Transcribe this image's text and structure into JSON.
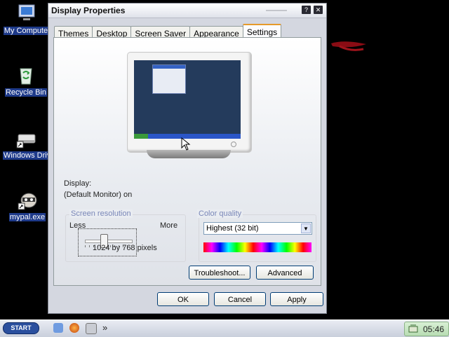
{
  "desktop": {
    "icons": [
      {
        "label": "My Compute"
      },
      {
        "label": "Recycle Bin"
      },
      {
        "label": "Windows Driv"
      },
      {
        "label": "mypal.exe"
      }
    ]
  },
  "window": {
    "title": "Display Properties",
    "help_glyph": "?",
    "close_glyph": "✕",
    "tabs": [
      {
        "label": "Themes"
      },
      {
        "label": "Desktop"
      },
      {
        "label": "Screen Saver"
      },
      {
        "label": "Appearance"
      },
      {
        "label": "Settings",
        "active": true
      }
    ],
    "display_label": "Display:",
    "display_value": "(Default Monitor) on",
    "resolution": {
      "group_label": "Screen resolution",
      "less_label": "Less",
      "more_label": "More",
      "value_text": "1024 by 768 pixels",
      "slider_position": 0.33
    },
    "color_quality": {
      "group_label": "Color quality",
      "selected": "Highest (32 bit)"
    },
    "buttons": {
      "troubleshoot": "Troubleshoot...",
      "advanced": "Advanced",
      "ok": "OK",
      "cancel": "Cancel",
      "apply": "Apply"
    }
  },
  "taskbar": {
    "start_label": "START",
    "more_glyph": "»",
    "clock": "05:46"
  }
}
